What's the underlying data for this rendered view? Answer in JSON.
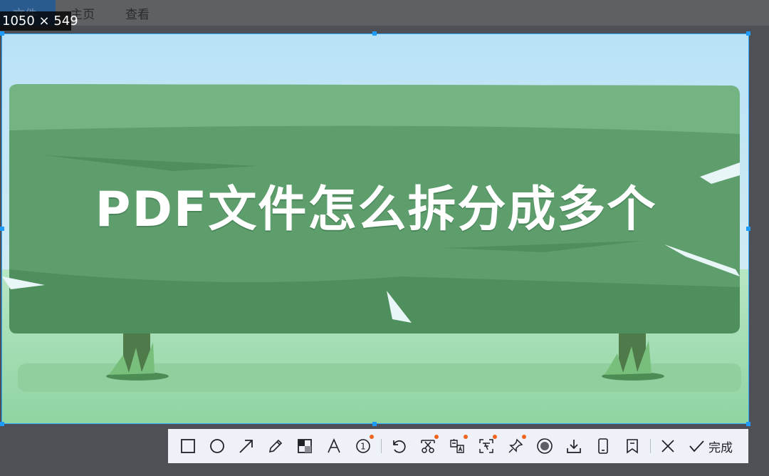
{
  "menu": {
    "items": [
      "文件",
      "主页",
      "查看"
    ]
  },
  "selection": {
    "size_label": "1050 × 549",
    "image_title": "PDF文件怎么拆分成多个"
  },
  "toolbar": {
    "tools": [
      {
        "name": "rectangle-icon"
      },
      {
        "name": "ellipse-icon"
      },
      {
        "name": "arrow-icon"
      },
      {
        "name": "pencil-icon"
      },
      {
        "name": "mosaic-icon"
      },
      {
        "name": "text-icon"
      },
      {
        "name": "number-marker-icon",
        "glyph": "1",
        "badge": true
      },
      {
        "name": "undo-icon"
      },
      {
        "name": "scissors-icon",
        "badge": true
      },
      {
        "name": "translate-icon",
        "badge": true
      },
      {
        "name": "ocr-icon",
        "badge": true
      },
      {
        "name": "pin-icon",
        "badge": true
      },
      {
        "name": "record-icon"
      },
      {
        "name": "download-icon"
      },
      {
        "name": "device-icon"
      },
      {
        "name": "bookmark-icon"
      },
      {
        "name": "close-icon"
      }
    ],
    "done_label": "完成"
  },
  "colors": {
    "accent": "#2ea8ff",
    "badge": "#f0641e",
    "board_green": "#5e9e6c",
    "sky": "#a6d8f0"
  }
}
